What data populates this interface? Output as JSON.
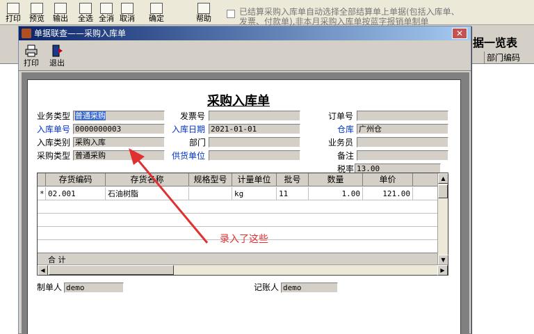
{
  "bg": {
    "toolbar": [
      {
        "label": "打印",
        "icon": "printer-icon"
      },
      {
        "label": "预览",
        "icon": "preview-icon"
      },
      {
        "label": "输出",
        "icon": "export-icon"
      },
      {
        "label": "全选",
        "icon": "select-all-icon"
      },
      {
        "label": "全消",
        "icon": "deselect-all-icon"
      },
      {
        "label": "取消",
        "icon": "cancel-icon"
      },
      {
        "label": "确定",
        "icon": "confirm-icon"
      },
      {
        "label": "帮助",
        "icon": "help-icon"
      }
    ],
    "note": "已结算采购入库单自动选择全部结算单上单据(包括入库单、发票、付款单),非本月采购入库单按蓝字报销单制单",
    "heading": "据一览表",
    "column_dept": "部门编码"
  },
  "dialog": {
    "title": "单据联查——采购入库单",
    "toolbar": {
      "print": "打印",
      "exit": "退出"
    },
    "form": {
      "title": "采购入库单",
      "labels": {
        "biz_type": "业务类型",
        "invoice_no": "发票号",
        "order_no": "订单号",
        "in_no": "入库单号",
        "in_date": "入库日期",
        "warehouse": "仓库",
        "in_category": "入库类别",
        "dept": "部门",
        "salesman": "业务员",
        "purchase_type": "采购类型",
        "supplier": "供货单位",
        "remark": "备注",
        "tax_rate": "税率",
        "maker": "制单人",
        "bookkeeper": "记账人"
      },
      "values": {
        "biz_type": "普通采购",
        "invoice_no": "",
        "order_no": "",
        "in_no": "0000000003",
        "in_date": "2021-01-01",
        "warehouse": "广州仓",
        "in_category": "采购入库",
        "dept": "",
        "salesman": "",
        "purchase_type": "普通采购",
        "supplier": "",
        "remark": "",
        "tax_rate": "13.00",
        "maker": "demo",
        "bookkeeper": "demo"
      },
      "grid": {
        "columns": [
          "存货编码",
          "存货名称",
          "规格型号",
          "计量单位",
          "批号",
          "数量",
          "单价"
        ],
        "rows": [
          {
            "marker": "*",
            "code": "02.001",
            "name": "石油树脂",
            "spec": "",
            "unit": "kg",
            "batch": "11",
            "qty": "1.00",
            "price": "121.00"
          }
        ],
        "total_label": "合 计"
      }
    },
    "annotation": "录入了这些"
  }
}
